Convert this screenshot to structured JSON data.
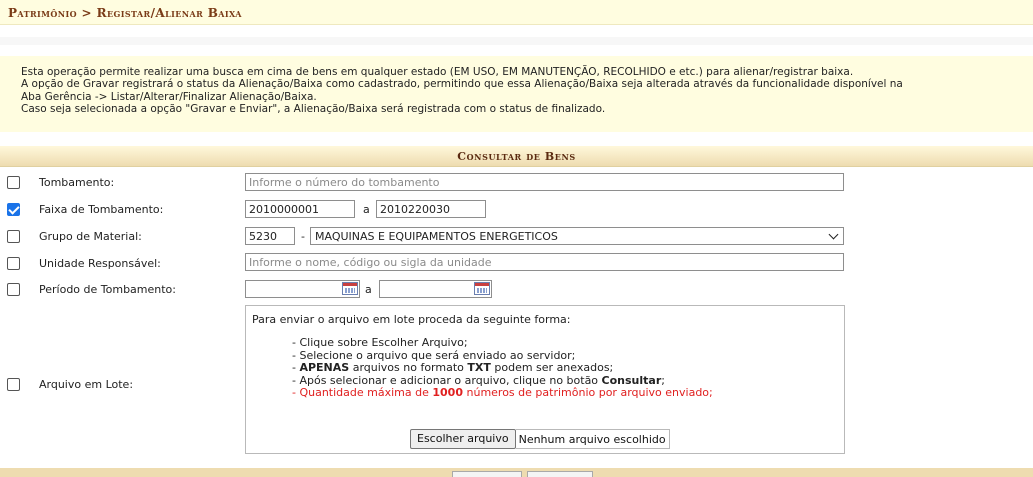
{
  "breadcrumb": "Patrimônio > Registar/Alienar Baixa",
  "info_lines": [
    "Esta operação permite realizar uma busca em cima de bens em qualquer estado (EM USO, EM MANUTENÇÃO, RECOLHIDO e etc.) para alienar/registrar baixa.",
    "A opção de Gravar registrará o status da Alienação/Baixa como cadastrado, permitindo que essa Alienação/Baixa seja alterada através da funcionalidade disponível na",
    "Aba Gerência -> Listar/Alterar/Finalizar Alienação/Baixa.",
    "Caso seja selecionada a opção \"Gravar e Enviar\", a Alienação/Baixa será registrada com o status de finalizado."
  ],
  "section_title": "Consultar de Bens",
  "fields": {
    "tombamento": {
      "label": "Tombamento:",
      "checked": false,
      "placeholder": "Informe o número do tombamento"
    },
    "faixa": {
      "label": "Faixa de Tombamento:",
      "checked": true,
      "from": "2010000001",
      "sep": "a",
      "to": "2010220030"
    },
    "grupo": {
      "label": "Grupo de Material:",
      "checked": false,
      "code": "5230",
      "sep": "-",
      "selected": "MAQUINAS E EQUIPAMENTOS ENERGETICOS"
    },
    "unidade": {
      "label": "Unidade Responsável:",
      "checked": false,
      "placeholder": "Informe o nome, código ou sigla da unidade"
    },
    "periodo": {
      "label": "Período de Tombamento:",
      "checked": false,
      "from": "",
      "sep": "a",
      "to": ""
    },
    "lote": {
      "label": "Arquivo em Lote:",
      "checked": false
    }
  },
  "lote_box": {
    "intro": "Para enviar o arquivo em lote proceda da seguinte forma:",
    "step1": "- Clique sobre Escolher Arquivo;",
    "step2": "- Selecione o arquivo que será enviado ao servidor;",
    "step3_pre": "- ",
    "step3_bold": "APENAS",
    "step3_mid": " arquivos no formato ",
    "step3_bold2": "TXT",
    "step3_post": " podem ser anexados;",
    "step4_pre": "- Após selecionar e adicionar o arquivo, clique no botão ",
    "step4_bold": "Consultar",
    "step4_post": ";",
    "step5_pre": "- Quantidade máxima de ",
    "step5_bold": "1000",
    "step5_post": " números de patrimônio por arquivo enviado;",
    "file_button": "Escolher arquivo",
    "file_status": "Nenhum arquivo escolhido"
  },
  "colors": {
    "warning_text": "#e02020",
    "title_text": "#7a3b17",
    "checkbox_on": "#1a73e8"
  }
}
